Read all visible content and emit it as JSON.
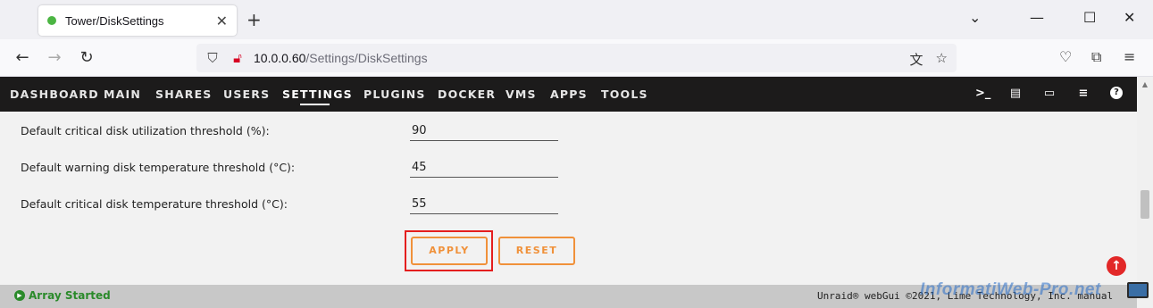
{
  "browser": {
    "tab_title": "Tower/DiskSettings",
    "tab_close": "✕",
    "new_tab": "+",
    "url_host": "10.0.0.60",
    "url_path": "/Settings/DiskSettings",
    "window_controls": {
      "list": "⌄",
      "minimize": "—",
      "maximize": "☐",
      "close": "✕"
    }
  },
  "menu": {
    "items": [
      {
        "label": "DASHBOARD"
      },
      {
        "label": "MAIN"
      },
      {
        "label": "SHARES"
      },
      {
        "label": "USERS"
      },
      {
        "label": "SETTINGS",
        "active": true
      },
      {
        "label": "PLUGINS"
      },
      {
        "label": "DOCKER"
      },
      {
        "label": "VMS"
      },
      {
        "label": "APPS"
      },
      {
        "label": "TOOLS"
      }
    ],
    "icons": [
      "terminal-icon",
      "feedback-icon",
      "monitor-icon",
      "log-icon",
      "help-icon"
    ]
  },
  "settings": {
    "rows": [
      {
        "label": "Default critical disk utilization threshold (%):",
        "value": "90"
      },
      {
        "label": "Default warning disk temperature threshold (°C):",
        "value": "45"
      },
      {
        "label": "Default critical disk temperature threshold (°C):",
        "value": "55"
      }
    ],
    "apply_label": "APPLY",
    "reset_label": "RESET"
  },
  "footer": {
    "status": "Array Started",
    "copyright": "Unraid® webGui ©2021, Lime Technology, Inc. manual"
  },
  "watermark": "InformatiWeb-Pro.net",
  "colors": {
    "menu_bg": "#1c1b1b",
    "accent_orange": "#f0913a",
    "status_green": "#2a8a2a",
    "highlight_red": "#e41e1e"
  }
}
